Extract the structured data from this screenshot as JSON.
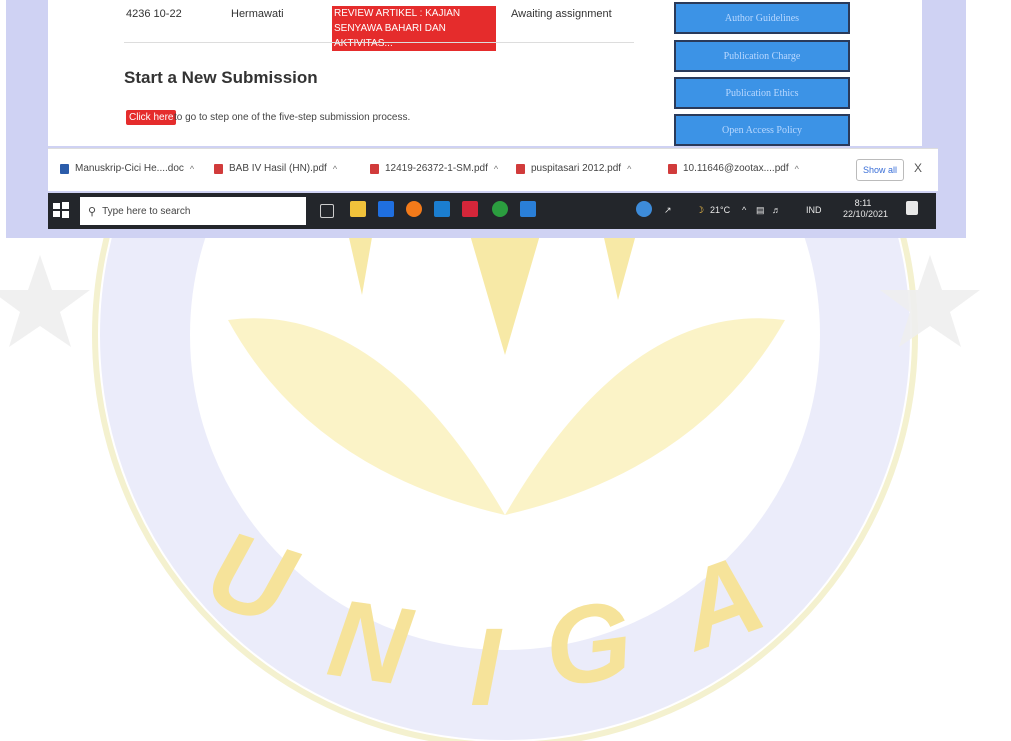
{
  "submission_row": {
    "id": "4236",
    "date": "10-22",
    "author": "Hermawati",
    "title": "REVIEW ARTIKEL : KAJIAN SENYAWA BAHARI DAN AKTIVITAS...",
    "status": "Awaiting assignment"
  },
  "new_submission": {
    "heading": "Start a New Submission",
    "button_label": "Click here",
    "description": "to go to step one of the five-step submission process."
  },
  "sidebar_buttons": [
    "Author Guidelines",
    "Publication Charge",
    "Publication Ethics",
    "Open Access Policy"
  ],
  "downloads": [
    {
      "name": "Manuskrip-Cici He....doc",
      "type": "doc"
    },
    {
      "name": "BAB IV Hasil (HN).pdf",
      "type": "pdf"
    },
    {
      "name": "12419-26372-1-SM.pdf",
      "type": "pdf"
    },
    {
      "name": "puspitasari 2012.pdf",
      "type": "pdf"
    },
    {
      "name": "10.11646@zootax....pdf",
      "type": "pdf"
    }
  ],
  "downloads_bar": {
    "show_all": "Show all",
    "close_symbol": "X"
  },
  "taskbar": {
    "search_placeholder": "Type here to search",
    "weather": "21°C",
    "language": "IND",
    "time": "8:11",
    "date": "22/10/2021"
  },
  "watermark": {
    "letters": [
      "U",
      "N",
      "I",
      "G",
      "A"
    ],
    "color": "#f6e39a",
    "ring_color": "#e7e9f9"
  },
  "colors": {
    "accent_red": "#e52c2c",
    "sidebar_blue": "#3c93e6",
    "page_bg": "#cfd2f3"
  }
}
